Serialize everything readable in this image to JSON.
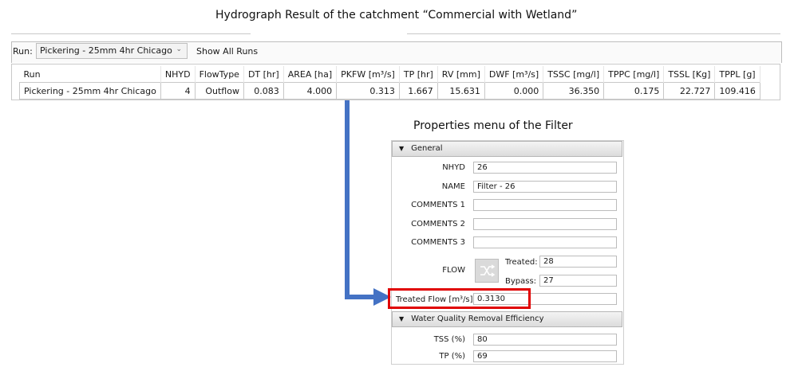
{
  "heading": "Hydrograph Result of the catchment “Commercial with Wetland”",
  "run_bar": {
    "label": "Run:",
    "selected": "Pickering - 25mm 4hr Chicago",
    "show_all": "Show All Runs"
  },
  "results": {
    "columns": [
      "Run",
      "NHYD",
      "FlowType",
      "DT [hr]",
      "AREA [ha]",
      "PKFW [m³/s]",
      "TP [hr]",
      "RV [mm]",
      "DWF [m³/s]",
      "TSSC [mg/l]",
      "TPPC [mg/l]",
      "TSSL [Kg]",
      "TPPL [g]"
    ],
    "rows": [
      [
        "Pickering - 25mm 4hr Chicago",
        "4",
        "Outflow",
        "0.083",
        "4.000",
        "0.313",
        "1.667",
        "15.631",
        "0.000",
        "36.350",
        "0.175",
        "22.727",
        "109.416"
      ]
    ]
  },
  "properties_title": "Properties menu of the Filter",
  "general": {
    "header": "General",
    "nhyd_label": "NHYD",
    "nhyd": "26",
    "name_label": "NAME",
    "name": "Filter - 26",
    "c1_label": "COMMENTS 1",
    "c1": "",
    "c2_label": "COMMENTS 2",
    "c2": "",
    "c3_label": "COMMENTS 3",
    "c3": "",
    "flow_label": "FLOW",
    "treated_label": "Treated:",
    "treated": "28",
    "bypass_label": "Bypass:",
    "bypass": "27",
    "treated_flow_label": "Treated Flow [m³/s]",
    "treated_flow": "0.3130"
  },
  "wq": {
    "header": "Water Quality Removal Efficiency",
    "tss_label": "TSS (%)",
    "tss": "80",
    "tp_label": "TP (%)",
    "tp": "69"
  },
  "colors": {
    "highlight": "#e00000",
    "connector": "#4472c4"
  }
}
